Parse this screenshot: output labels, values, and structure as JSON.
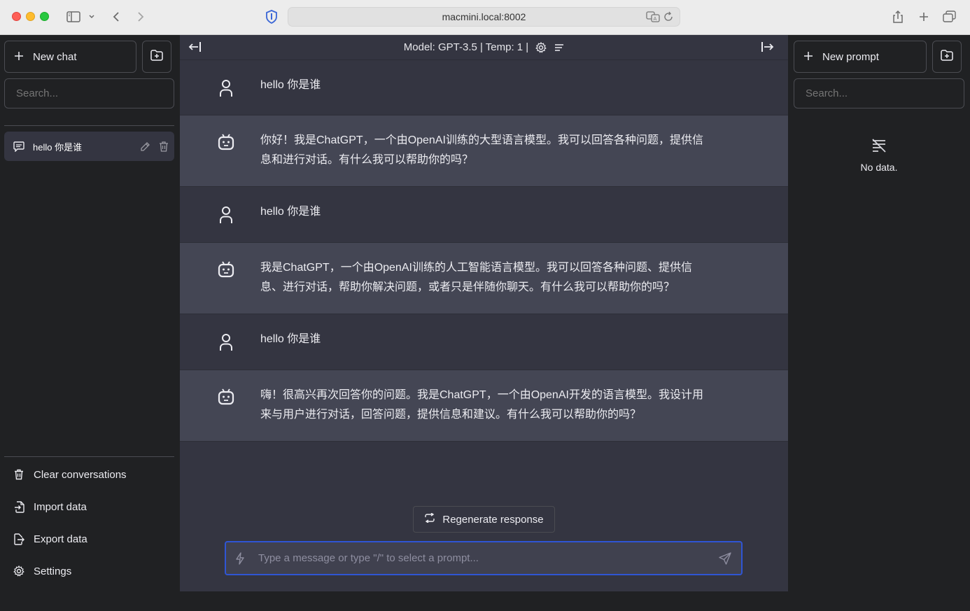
{
  "browser": {
    "url": "macmini.local:8002"
  },
  "left_sidebar": {
    "new_chat_label": "New chat",
    "search_placeholder": "Search...",
    "conversations": [
      {
        "title": "hello 你是谁"
      }
    ],
    "bottom_items": [
      {
        "label": "Clear conversations",
        "icon": "trash-icon"
      },
      {
        "label": "Import data",
        "icon": "file-import-icon"
      },
      {
        "label": "Export data",
        "icon": "file-export-icon"
      },
      {
        "label": "Settings",
        "icon": "gear-icon"
      }
    ]
  },
  "header": {
    "model_info": "Model: GPT-3.5 | Temp: 1 |"
  },
  "messages": [
    {
      "role": "user",
      "lines": [
        "hello 你是谁"
      ]
    },
    {
      "role": "assistant",
      "lines": [
        "你好！我是ChatGPT，一个由OpenAI训练的大型语言模型。我可以回答各种问题，提供信",
        "息和进行对话。有什么我可以帮助你的吗？"
      ]
    },
    {
      "role": "user",
      "lines": [
        "hello 你是谁"
      ]
    },
    {
      "role": "assistant",
      "lines": [
        "我是ChatGPT，一个由OpenAI训练的人工智能语言模型。我可以回答各种问题、提供信",
        "息、进行对话，帮助你解决问题，或者只是伴随你聊天。有什么我可以帮助你的吗？"
      ]
    },
    {
      "role": "user",
      "lines": [
        "hello 你是谁"
      ]
    },
    {
      "role": "assistant",
      "lines": [
        "嗨！很高兴再次回答你的问题。我是ChatGPT，一个由OpenAI开发的语言模型。我设计用",
        "来与用户进行对话，回答问题，提供信息和建议。有什么我可以帮助你的吗？"
      ]
    }
  ],
  "regenerate_label": "Regenerate response",
  "input": {
    "placeholder": "Type a message or type \"/\" to select a prompt..."
  },
  "right_sidebar": {
    "new_prompt_label": "New prompt",
    "search_placeholder": "Search...",
    "empty_text": "No data."
  },
  "colors": {
    "sidebar_bg": "#202123",
    "main_bg": "#343541",
    "assistant_bg": "#444654",
    "input_focus": "#2f55d4"
  }
}
